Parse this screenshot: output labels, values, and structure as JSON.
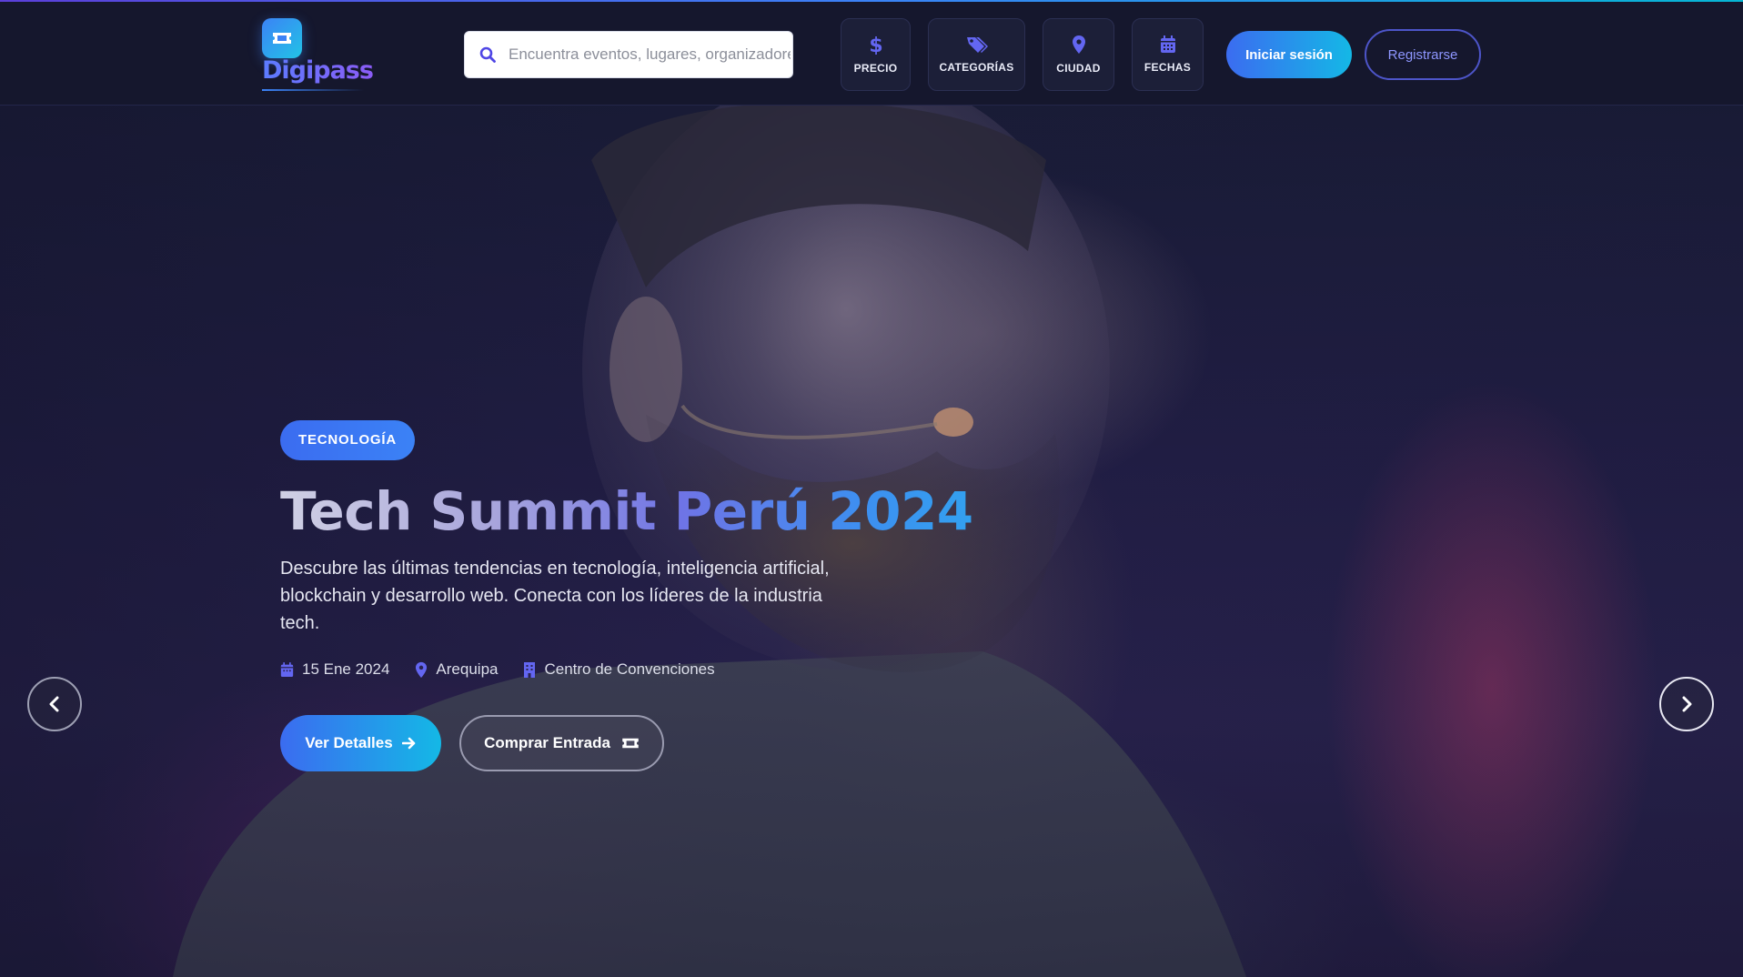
{
  "brand": {
    "name": "Digipass",
    "icon": "ticket-icon",
    "accent": "#3b82f6"
  },
  "search": {
    "placeholder": "Encuentra eventos, lugares, organizadores...",
    "icon": "search-icon"
  },
  "filters": [
    {
      "label": "PRECIO",
      "icon": "dollar-icon"
    },
    {
      "label": "CATEGORÍAS",
      "icon": "tag-icon"
    },
    {
      "label": "CIUDAD",
      "icon": "map-pin-icon"
    },
    {
      "label": "FECHAS",
      "icon": "calendar-icon"
    }
  ],
  "auth": {
    "login_label": "Iniciar sesión",
    "register_label": "Registrarse"
  },
  "hero": {
    "badge": "TECNOLOGÍA",
    "title": "Tech Summit Perú 2024",
    "description": "Descubre las últimas tendencias en tecnología, inteligencia artificial, blockchain y desarrollo web. Conecta con los líderes de la industria tech.",
    "meta": {
      "date": "15 Ene 2024",
      "city": "Arequipa",
      "venue": "Centro de Convenciones"
    },
    "details_label": "Ver Detalles",
    "buy_label": "Comprar Entrada"
  },
  "colors": {
    "primary_gradient_start": "#3b6cf0",
    "primary_gradient_end": "#14b8e6",
    "icon_accent": "#6366f1"
  }
}
